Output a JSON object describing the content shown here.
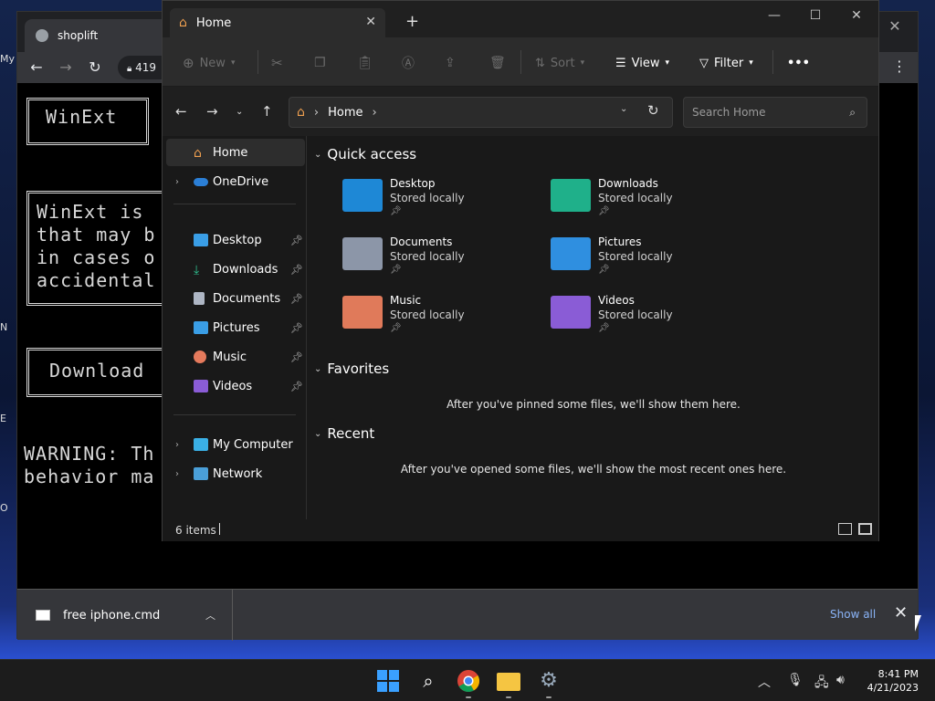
{
  "browser": {
    "tab_title": "shoplift",
    "omnibox_text": "419",
    "page": {
      "title_box": "WinExt",
      "description": "WinExt is\nthat may b\nin cases o\naccidental",
      "download_button": "Download",
      "warning": "WARNING: Th\nbehavior ma"
    },
    "download_shelf": {
      "file_name": "free iphone.cmd",
      "show_all": "Show all"
    }
  },
  "desktop_icons": [
    "My",
    "N",
    "E",
    "O"
  ],
  "explorer": {
    "tab_title": "Home",
    "command_bar": {
      "new": "New",
      "sort": "Sort",
      "view": "View",
      "filter": "Filter",
      "more": "•••"
    },
    "address_path": "Home",
    "search_placeholder": "Search Home",
    "nav_pane": {
      "home": "Home",
      "onedrive": "OneDrive",
      "pinned": [
        "Desktop",
        "Downloads",
        "Documents",
        "Pictures",
        "Music",
        "Videos"
      ],
      "my_computer": "My Computer",
      "network": "Network"
    },
    "sections": {
      "quick_access": "Quick access",
      "favorites": "Favorites",
      "recent": "Recent",
      "favorites_empty": "After you've pinned some files, we'll show them here.",
      "recent_empty": "After you've opened some files, we'll show the most recent ones here."
    },
    "quick_access_items": [
      {
        "name": "Desktop",
        "sub": "Stored locally"
      },
      {
        "name": "Downloads",
        "sub": "Stored locally"
      },
      {
        "name": "Documents",
        "sub": "Stored locally"
      },
      {
        "name": "Pictures",
        "sub": "Stored locally"
      },
      {
        "name": "Music",
        "sub": "Stored locally"
      },
      {
        "name": "Videos",
        "sub": "Stored locally"
      }
    ],
    "status": {
      "item_count": "6 items"
    }
  },
  "taskbar": {
    "time": "8:41 PM",
    "date": "4/21/2023"
  },
  "colors": {
    "accent_blue": "#4ca0e0",
    "folder_desktop": "#1e88d6",
    "folder_downloads": "#1fb08a",
    "folder_documents": "#8c96a8",
    "folder_pictures": "#2f8fe0",
    "folder_music": "#e07a5a",
    "folder_videos": "#8a5cd6"
  }
}
